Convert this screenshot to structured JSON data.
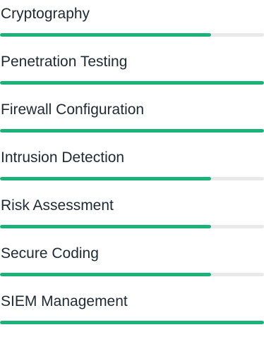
{
  "theme": {
    "fill_color": "#1bb27a",
    "track_color": "#e9e9ea"
  },
  "skills": [
    {
      "label": "Cryptography",
      "progress": 0.8
    },
    {
      "label": "Penetration Testing",
      "progress": 1.0
    },
    {
      "label": "Firewall Configuration",
      "progress": 1.0
    },
    {
      "label": "Intrusion Detection",
      "progress": 0.8
    },
    {
      "label": "Risk Assessment",
      "progress": 0.8
    },
    {
      "label": "Secure Coding",
      "progress": 0.8
    },
    {
      "label": "SIEM Management",
      "progress": 1.0
    }
  ]
}
